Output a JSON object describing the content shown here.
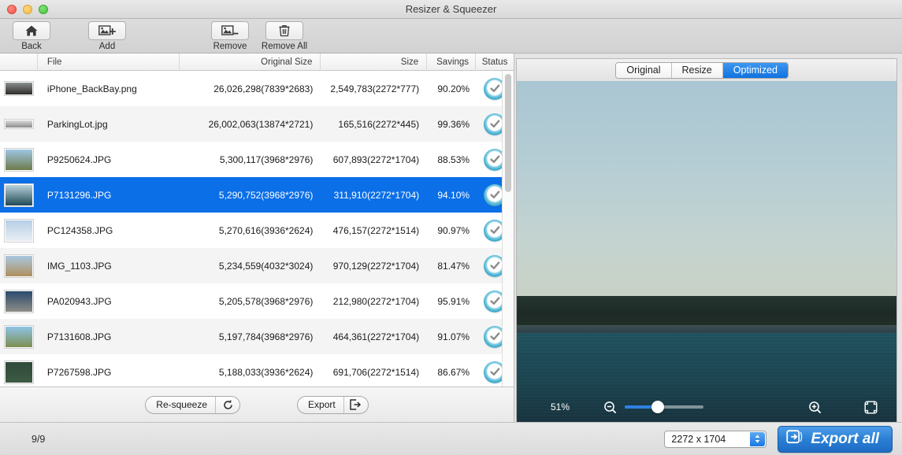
{
  "window": {
    "title": "Resizer & Squeezer"
  },
  "toolbar": {
    "buttons": [
      {
        "label": "Back",
        "icon": "home-icon"
      },
      {
        "label": "Add",
        "icon": "add-image-icon"
      },
      {
        "label": "Remove",
        "icon": "remove-image-icon"
      },
      {
        "label": "Remove All",
        "icon": "trash-icon"
      }
    ]
  },
  "list": {
    "columns": [
      "File",
      "Original Size",
      "Size",
      "Savings",
      "Status"
    ],
    "rows": [
      {
        "file": "iPhone_BackBay.png",
        "original_size": "26,026,298(7839*2683)",
        "size": "2,549,783(2272*777)",
        "savings": "90.20%",
        "status": "done",
        "selected": false
      },
      {
        "file": "ParkingLot.jpg",
        "original_size": "26,002,063(13874*2721)",
        "size": "165,516(2272*445)",
        "savings": "99.36%",
        "status": "done",
        "selected": false
      },
      {
        "file": "P9250624.JPG",
        "original_size": "5,300,117(3968*2976)",
        "size": "607,893(2272*1704)",
        "savings": "88.53%",
        "status": "done",
        "selected": false
      },
      {
        "file": "P7131296.JPG",
        "original_size": "5,290,752(3968*2976)",
        "size": "311,910(2272*1704)",
        "savings": "94.10%",
        "status": "done",
        "selected": true
      },
      {
        "file": "PC124358.JPG",
        "original_size": "5,270,616(3936*2624)",
        "size": "476,157(2272*1514)",
        "savings": "90.97%",
        "status": "done",
        "selected": false
      },
      {
        "file": "IMG_1103.JPG",
        "original_size": "5,234,559(4032*3024)",
        "size": "970,129(2272*1704)",
        "savings": "81.47%",
        "status": "done",
        "selected": false
      },
      {
        "file": "PA020943.JPG",
        "original_size": "5,205,578(3968*2976)",
        "size": "212,980(2272*1704)",
        "savings": "95.91%",
        "status": "done",
        "selected": false
      },
      {
        "file": "P7131608.JPG",
        "original_size": "5,197,784(3968*2976)",
        "size": "464,361(2272*1704)",
        "savings": "91.07%",
        "status": "done",
        "selected": false
      },
      {
        "file": "P7267598.JPG",
        "original_size": "5,188,033(3936*2624)",
        "size": "691,706(2272*1514)",
        "savings": "86.67%",
        "status": "done",
        "selected": false
      }
    ]
  },
  "left_actions": {
    "resqueeze_label": "Re-squeeze",
    "resqueeze_icon": "refresh-icon",
    "export_label": "Export",
    "export_icon": "export-icon"
  },
  "preview": {
    "tabs": [
      {
        "label": "Original",
        "active": false
      },
      {
        "label": "Resize",
        "active": false
      },
      {
        "label": "Optimized",
        "active": true
      }
    ],
    "zoom_percent": "51%",
    "zoom_out_icon": "zoom-out-icon",
    "zoom_in_icon": "zoom-in-icon",
    "fit_icon": "fit-to-screen-icon"
  },
  "statusbar": {
    "count": "9/9",
    "dimension_value": "2272 x 1704",
    "export_all_label": "Export all",
    "export_all_icon": "export-icon"
  },
  "colors": {
    "accent_blue": "#0b6fe8",
    "tab_active": "#1172e0",
    "check_ring": "#39a8cc"
  }
}
